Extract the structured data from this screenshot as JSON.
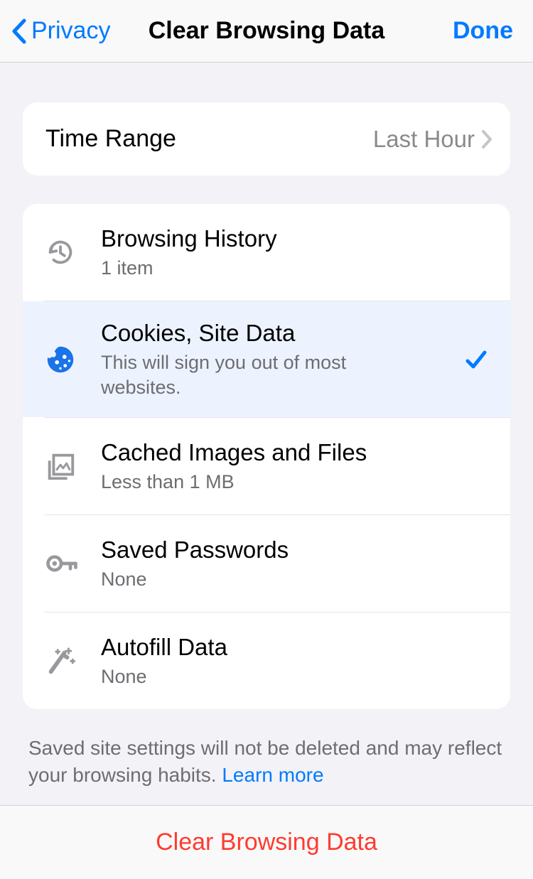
{
  "navbar": {
    "back_label": "Privacy",
    "title": "Clear Browsing Data",
    "done_label": "Done"
  },
  "time_range": {
    "label": "Time Range",
    "value": "Last Hour"
  },
  "items": [
    {
      "title": "Browsing History",
      "sub": "1 item"
    },
    {
      "title": "Cookies, Site Data",
      "sub": "This will sign you out of most websites."
    },
    {
      "title": "Cached Images and Files",
      "sub": "Less than 1 MB"
    },
    {
      "title": "Saved Passwords",
      "sub": "None"
    },
    {
      "title": "Autofill Data",
      "sub": "None"
    }
  ],
  "footer": {
    "note": "Saved site settings will not be deleted and may reflect your browsing habits. ",
    "learn_more": "Learn more"
  },
  "bottom": {
    "clear_label": "Clear Browsing Data"
  }
}
